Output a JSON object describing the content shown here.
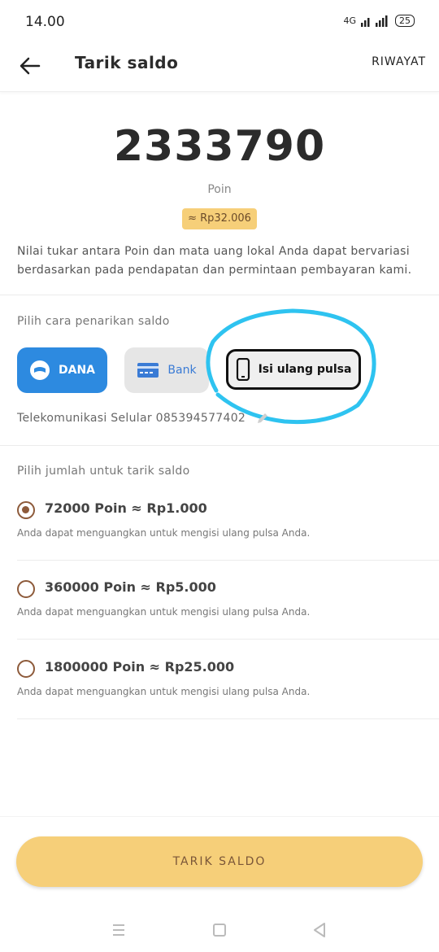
{
  "status_bar": {
    "time": "14.00",
    "network": "4G",
    "battery": "25"
  },
  "header": {
    "title": "Tarik saldo",
    "history_label": "RIWAYAT"
  },
  "balance": {
    "points": "2333790",
    "points_label": "Poin",
    "rupiah_approx": "≈ Rp32.006",
    "description": "Nilai tukar antara Poin dan mata uang lokal Anda dapat bervariasi berdasarkan pada pendapatan dan permintaan pembayaran kami."
  },
  "withdraw_method": {
    "label": "Pilih cara penarikan saldo",
    "methods": [
      {
        "label": "DANA",
        "selected": false
      },
      {
        "label": "Bank",
        "selected": false
      },
      {
        "label": "Isi ulang pulsa",
        "selected": true
      }
    ],
    "phone_info": "Telekomunikasi Selular 085394577402"
  },
  "amount": {
    "label": "Pilih jumlah untuk tarik saldo",
    "options": [
      {
        "title": "72000 Poin ≈ Rp1.000",
        "subtitle": "Anda dapat menguangkan untuk mengisi ulang pulsa Anda.",
        "selected": true
      },
      {
        "title": "360000 Poin ≈ Rp5.000",
        "subtitle": "Anda dapat menguangkan untuk mengisi ulang pulsa Anda.",
        "selected": false
      },
      {
        "title": "1800000 Poin ≈ Rp25.000",
        "subtitle": "Anda dapat menguangkan untuk mengisi ulang pulsa Anda.",
        "selected": false
      }
    ]
  },
  "action": {
    "button_label": "TARIK SALDO"
  },
  "colors": {
    "accent": "#f6cf79",
    "dana": "#2d8ae0",
    "radio": "#8d5a3a",
    "annotation": "#2ec3f0"
  }
}
